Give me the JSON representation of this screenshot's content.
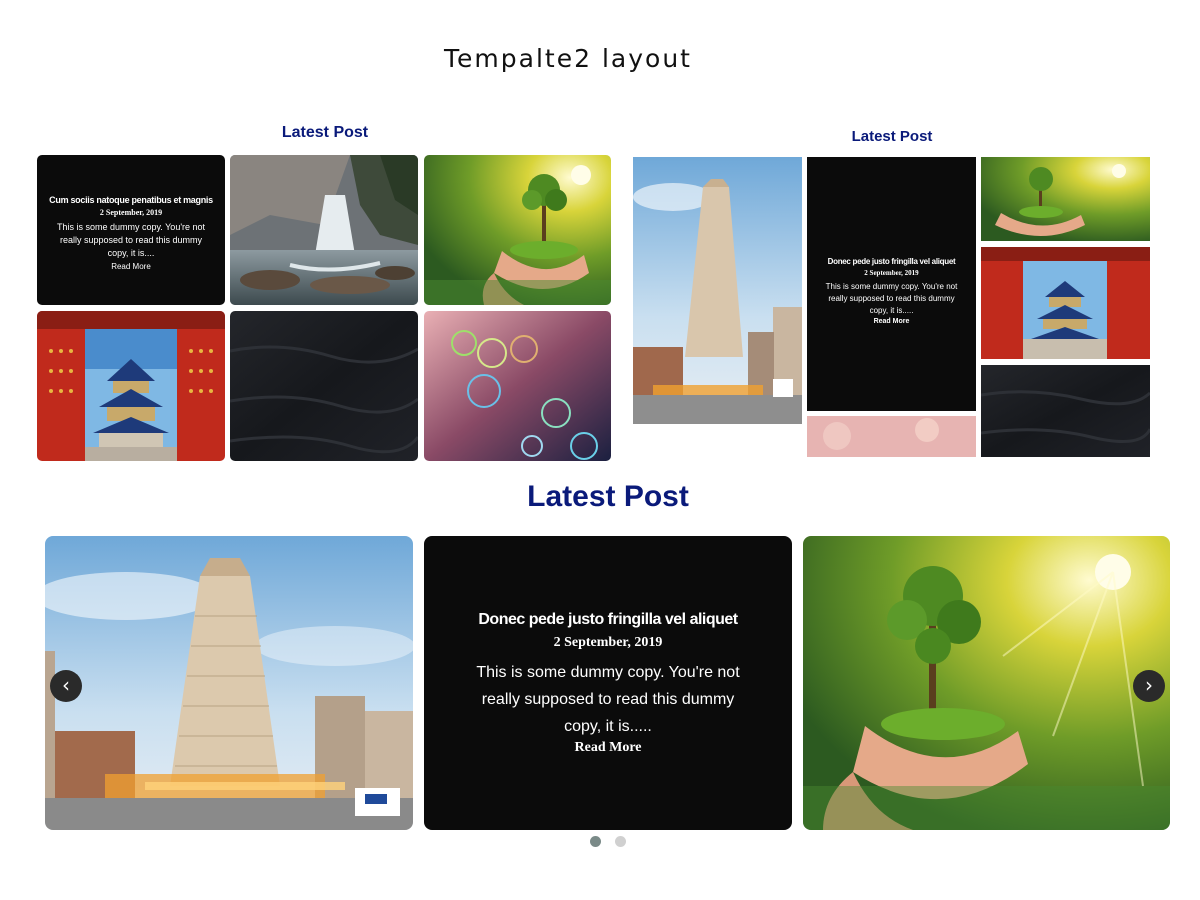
{
  "page_title": "Tempalte2 layout",
  "left_grid": {
    "heading": "Latest Post",
    "post": {
      "title": "Cum sociis natoque penatibus et magnis",
      "date": "2 September, 2019",
      "excerpt": "This is some dummy copy. You're not really supposed to read this dummy copy, it is....",
      "read_more": "Read More"
    },
    "images": [
      "waterfall",
      "hands-holding-tree",
      "temple-of-heaven",
      "black-leather",
      "soap-bubbles"
    ]
  },
  "right_grid": {
    "heading": "Latest Post",
    "post": {
      "title": "Donec pede justo fringilla vel aliquet",
      "date": "2 September, 2019",
      "excerpt": "This is some dummy copy. You're not really supposed to read this dummy copy, it is.....",
      "read_more": "Read More"
    },
    "images": [
      "flatiron-building",
      "hands-holding-tree",
      "temple-of-heaven",
      "black-leather",
      "soap-bubbles"
    ]
  },
  "carousel": {
    "heading": "Latest Post",
    "post": {
      "title": "Donec pede justo fringilla vel aliquet",
      "date": "2 September, 2019",
      "excerpt": "This is some dummy copy. You're not really supposed to read this dummy copy, it is.....",
      "read_more": "Read More"
    },
    "prev_icon": "‹",
    "next_icon": "›",
    "dots": 2,
    "active_dot": 1
  },
  "colors": {
    "heading": "#0a1a7a",
    "card_dark": "#0b0b0b",
    "dot_active": "#7a8a88",
    "dot_inactive": "#d0d0d0"
  }
}
